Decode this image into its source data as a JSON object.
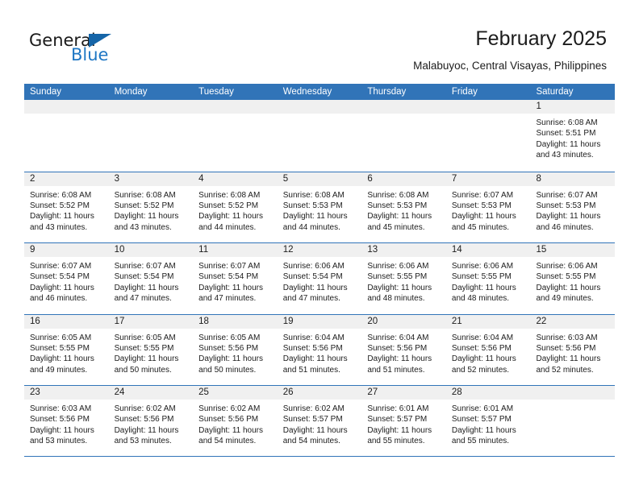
{
  "brand": {
    "name_dark": "General",
    "name_light": "Blue",
    "accent_color": "#1565a8",
    "light_color": "#1f77c4"
  },
  "header": {
    "title": "February 2025",
    "subtitle": "Malabuyoc, Central Visayas, Philippines"
  },
  "calendar": {
    "header_color": "#3174b8",
    "cell_head_color": "#f0f0f0",
    "weekdays": [
      "Sunday",
      "Monday",
      "Tuesday",
      "Wednesday",
      "Thursday",
      "Friday",
      "Saturday"
    ],
    "weeks": [
      [
        {
          "day": "",
          "lines": []
        },
        {
          "day": "",
          "lines": []
        },
        {
          "day": "",
          "lines": []
        },
        {
          "day": "",
          "lines": []
        },
        {
          "day": "",
          "lines": []
        },
        {
          "day": "",
          "lines": []
        },
        {
          "day": "1",
          "lines": [
            "Sunrise: 6:08 AM",
            "Sunset: 5:51 PM",
            "Daylight: 11 hours",
            "and 43 minutes."
          ]
        }
      ],
      [
        {
          "day": "2",
          "lines": [
            "Sunrise: 6:08 AM",
            "Sunset: 5:52 PM",
            "Daylight: 11 hours",
            "and 43 minutes."
          ]
        },
        {
          "day": "3",
          "lines": [
            "Sunrise: 6:08 AM",
            "Sunset: 5:52 PM",
            "Daylight: 11 hours",
            "and 43 minutes."
          ]
        },
        {
          "day": "4",
          "lines": [
            "Sunrise: 6:08 AM",
            "Sunset: 5:52 PM",
            "Daylight: 11 hours",
            "and 44 minutes."
          ]
        },
        {
          "day": "5",
          "lines": [
            "Sunrise: 6:08 AM",
            "Sunset: 5:53 PM",
            "Daylight: 11 hours",
            "and 44 minutes."
          ]
        },
        {
          "day": "6",
          "lines": [
            "Sunrise: 6:08 AM",
            "Sunset: 5:53 PM",
            "Daylight: 11 hours",
            "and 45 minutes."
          ]
        },
        {
          "day": "7",
          "lines": [
            "Sunrise: 6:07 AM",
            "Sunset: 5:53 PM",
            "Daylight: 11 hours",
            "and 45 minutes."
          ]
        },
        {
          "day": "8",
          "lines": [
            "Sunrise: 6:07 AM",
            "Sunset: 5:53 PM",
            "Daylight: 11 hours",
            "and 46 minutes."
          ]
        }
      ],
      [
        {
          "day": "9",
          "lines": [
            "Sunrise: 6:07 AM",
            "Sunset: 5:54 PM",
            "Daylight: 11 hours",
            "and 46 minutes."
          ]
        },
        {
          "day": "10",
          "lines": [
            "Sunrise: 6:07 AM",
            "Sunset: 5:54 PM",
            "Daylight: 11 hours",
            "and 47 minutes."
          ]
        },
        {
          "day": "11",
          "lines": [
            "Sunrise: 6:07 AM",
            "Sunset: 5:54 PM",
            "Daylight: 11 hours",
            "and 47 minutes."
          ]
        },
        {
          "day": "12",
          "lines": [
            "Sunrise: 6:06 AM",
            "Sunset: 5:54 PM",
            "Daylight: 11 hours",
            "and 47 minutes."
          ]
        },
        {
          "day": "13",
          "lines": [
            "Sunrise: 6:06 AM",
            "Sunset: 5:55 PM",
            "Daylight: 11 hours",
            "and 48 minutes."
          ]
        },
        {
          "day": "14",
          "lines": [
            "Sunrise: 6:06 AM",
            "Sunset: 5:55 PM",
            "Daylight: 11 hours",
            "and 48 minutes."
          ]
        },
        {
          "day": "15",
          "lines": [
            "Sunrise: 6:06 AM",
            "Sunset: 5:55 PM",
            "Daylight: 11 hours",
            "and 49 minutes."
          ]
        }
      ],
      [
        {
          "day": "16",
          "lines": [
            "Sunrise: 6:05 AM",
            "Sunset: 5:55 PM",
            "Daylight: 11 hours",
            "and 49 minutes."
          ]
        },
        {
          "day": "17",
          "lines": [
            "Sunrise: 6:05 AM",
            "Sunset: 5:55 PM",
            "Daylight: 11 hours",
            "and 50 minutes."
          ]
        },
        {
          "day": "18",
          "lines": [
            "Sunrise: 6:05 AM",
            "Sunset: 5:56 PM",
            "Daylight: 11 hours",
            "and 50 minutes."
          ]
        },
        {
          "day": "19",
          "lines": [
            "Sunrise: 6:04 AM",
            "Sunset: 5:56 PM",
            "Daylight: 11 hours",
            "and 51 minutes."
          ]
        },
        {
          "day": "20",
          "lines": [
            "Sunrise: 6:04 AM",
            "Sunset: 5:56 PM",
            "Daylight: 11 hours",
            "and 51 minutes."
          ]
        },
        {
          "day": "21",
          "lines": [
            "Sunrise: 6:04 AM",
            "Sunset: 5:56 PM",
            "Daylight: 11 hours",
            "and 52 minutes."
          ]
        },
        {
          "day": "22",
          "lines": [
            "Sunrise: 6:03 AM",
            "Sunset: 5:56 PM",
            "Daylight: 11 hours",
            "and 52 minutes."
          ]
        }
      ],
      [
        {
          "day": "23",
          "lines": [
            "Sunrise: 6:03 AM",
            "Sunset: 5:56 PM",
            "Daylight: 11 hours",
            "and 53 minutes."
          ]
        },
        {
          "day": "24",
          "lines": [
            "Sunrise: 6:02 AM",
            "Sunset: 5:56 PM",
            "Daylight: 11 hours",
            "and 53 minutes."
          ]
        },
        {
          "day": "25",
          "lines": [
            "Sunrise: 6:02 AM",
            "Sunset: 5:56 PM",
            "Daylight: 11 hours",
            "and 54 minutes."
          ]
        },
        {
          "day": "26",
          "lines": [
            "Sunrise: 6:02 AM",
            "Sunset: 5:57 PM",
            "Daylight: 11 hours",
            "and 54 minutes."
          ]
        },
        {
          "day": "27",
          "lines": [
            "Sunrise: 6:01 AM",
            "Sunset: 5:57 PM",
            "Daylight: 11 hours",
            "and 55 minutes."
          ]
        },
        {
          "day": "28",
          "lines": [
            "Sunrise: 6:01 AM",
            "Sunset: 5:57 PM",
            "Daylight: 11 hours",
            "and 55 minutes."
          ]
        },
        {
          "day": "",
          "lines": []
        }
      ]
    ]
  }
}
